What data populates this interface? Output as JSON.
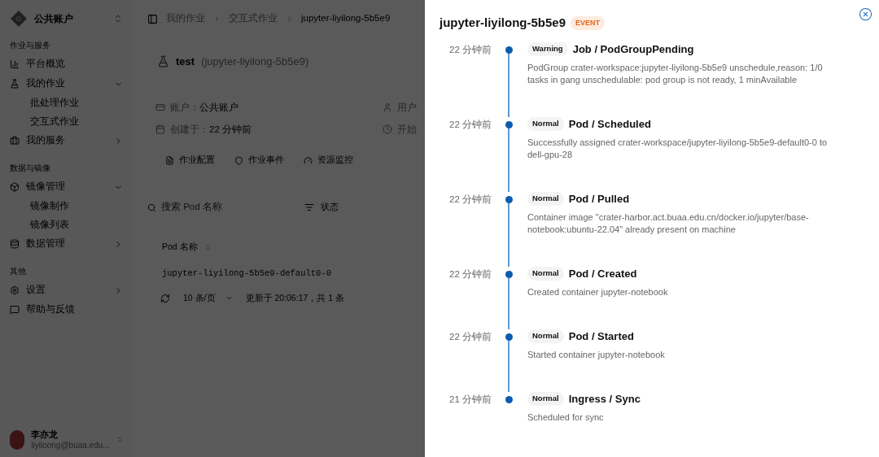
{
  "sidebar": {
    "account": "公共账户",
    "sections": [
      {
        "label": "作业与服务",
        "items": [
          {
            "label": "平台概览"
          },
          {
            "label": "我的作业",
            "expanded": true,
            "children": [
              {
                "label": "批处理作业"
              },
              {
                "label": "交互式作业"
              }
            ]
          },
          {
            "label": "我的服务",
            "expanded": false
          }
        ]
      },
      {
        "label": "数据与镜像",
        "items": [
          {
            "label": "镜像管理",
            "expanded": true,
            "children": [
              {
                "label": "镜像制作"
              },
              {
                "label": "镜像列表"
              }
            ]
          },
          {
            "label": "数据管理",
            "expanded": false
          }
        ]
      },
      {
        "label": "其他",
        "items": [
          {
            "label": "设置",
            "expanded": false
          },
          {
            "label": "帮助与反馈"
          }
        ]
      }
    ],
    "user": {
      "name": "李亦龙",
      "email": "liyiloong@buaa.edu..."
    }
  },
  "breadcrumb": [
    "我的作业",
    "交互式作业",
    "jupyter-liyilong-5b5e9"
  ],
  "job": {
    "name": "test",
    "id": "(jupyter-liyilong-5b5e9)",
    "info": [
      {
        "label": "账户：",
        "value": "公共账户"
      },
      {
        "label": "用户"
      },
      {
        "label": "创建于：",
        "value": "22 分钟前"
      },
      {
        "label": "开始"
      }
    ],
    "tabs": [
      "作业配置",
      "作业事件",
      "资源监控"
    ],
    "search": {
      "placeholder": "搜索 Pod 名称"
    },
    "filter": "状态",
    "table": {
      "columns": [
        "Pod 名称"
      ],
      "rows": [
        [
          "jupyter-liyilong-5b5e9-default0-0"
        ]
      ]
    },
    "pagination": {
      "page_size": "10 条/页",
      "status": "更新于 20:06:17，共 1 条"
    }
  },
  "drawer": {
    "title": "jupyter-liyilong-5b5e9",
    "badge": "EVENT",
    "events": [
      {
        "time": "22 分钟前",
        "type": "Warning",
        "title": "Job / PodGroupPending",
        "message": "PodGroup crater-workspace:jupyter-liyilong-5b5e9 unschedule,reason: 1/0 tasks in gang unschedulable: pod group is not ready, 1 minAvailable"
      },
      {
        "time": "22 分钟前",
        "type": "Normal",
        "title": "Pod / Scheduled",
        "message": "Successfully assigned crater-workspace/jupyter-liyilong-5b5e9-default0-0 to dell-gpu-28"
      },
      {
        "time": "22 分钟前",
        "type": "Normal",
        "title": "Pod / Pulled",
        "message": "Container image \"crater-harbor.act.buaa.edu.cn/docker.io/jupyter/base-notebook:ubuntu-22.04\" already present on machine"
      },
      {
        "time": "22 分钟前",
        "type": "Normal",
        "title": "Pod / Created",
        "message": "Created container jupyter-notebook"
      },
      {
        "time": "22 分钟前",
        "type": "Normal",
        "title": "Pod / Started",
        "message": "Started container jupyter-notebook"
      },
      {
        "time": "21 分钟前",
        "type": "Normal",
        "title": "Ingress / Sync",
        "message": "Scheduled for sync"
      }
    ]
  }
}
